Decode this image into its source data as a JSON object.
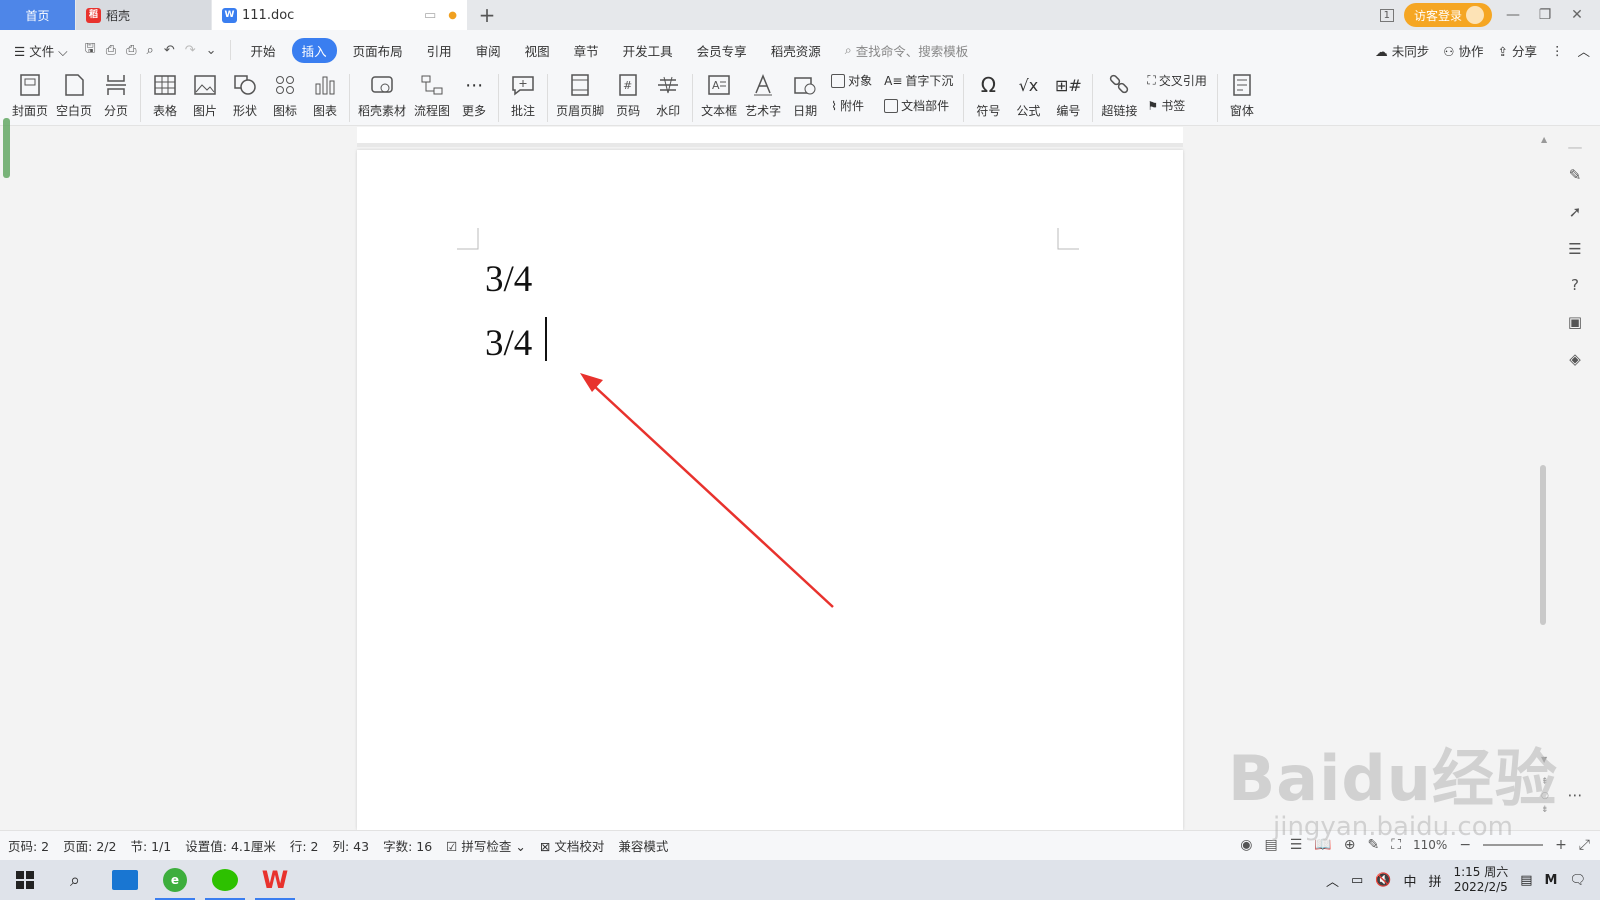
{
  "tabs": {
    "home": "首页",
    "daoke": "稻壳",
    "doc": "111.doc"
  },
  "topbar": {
    "login": "访客登录"
  },
  "menu": {
    "file": "文件",
    "items": [
      "开始",
      "插入",
      "页面布局",
      "引用",
      "审阅",
      "视图",
      "章节",
      "开发工具",
      "会员专享",
      "稻壳资源"
    ],
    "search_placeholder": "查找命令、搜索模板",
    "unsync": "未同步",
    "collab": "协作",
    "share": "分享"
  },
  "ribbon": {
    "cover": "封面页",
    "blank": "空白页",
    "pagebreak": "分页",
    "table": "表格",
    "picture": "图片",
    "shape": "形状",
    "icon": "图标",
    "chart": "图表",
    "material": "稻壳素材",
    "flowchart": "流程图",
    "more": "更多",
    "comment": "批注",
    "headerfooter": "页眉页脚",
    "pagenum": "页码",
    "watermark": "水印",
    "textbox": "文本框",
    "wordart": "艺术字",
    "date": "日期",
    "object": "对象",
    "attachment": "附件",
    "dropcap": "首字下沉",
    "docpart": "文档部件",
    "symbol": "符号",
    "formula": "公式",
    "numbering": "编号",
    "hyperlink": "超链接",
    "crossref": "交叉引用",
    "bookmark": "书签",
    "form": "窗体"
  },
  "document": {
    "lines": [
      "3/4",
      "3/4"
    ]
  },
  "annotation": {
    "arrow_color": "#e8322d"
  },
  "status": {
    "page": "页码: 2",
    "pages": "页面: 2/2",
    "section": "节: 1/1",
    "setting": "设置值: 4.1厘米",
    "row": "行: 2",
    "col": "列: 43",
    "wordcount": "字数: 16",
    "spell": "拼写检查",
    "proof": "文档校对",
    "compat": "兼容模式",
    "zoom": "110%"
  },
  "taskbar": {
    "time": "1:15 周六",
    "date": "2022/2/5",
    "ime_lang": "中",
    "ime_mode": "拼"
  },
  "watermark": {
    "brand": "Baidu经验",
    "url": "jingyan.baidu.com"
  }
}
